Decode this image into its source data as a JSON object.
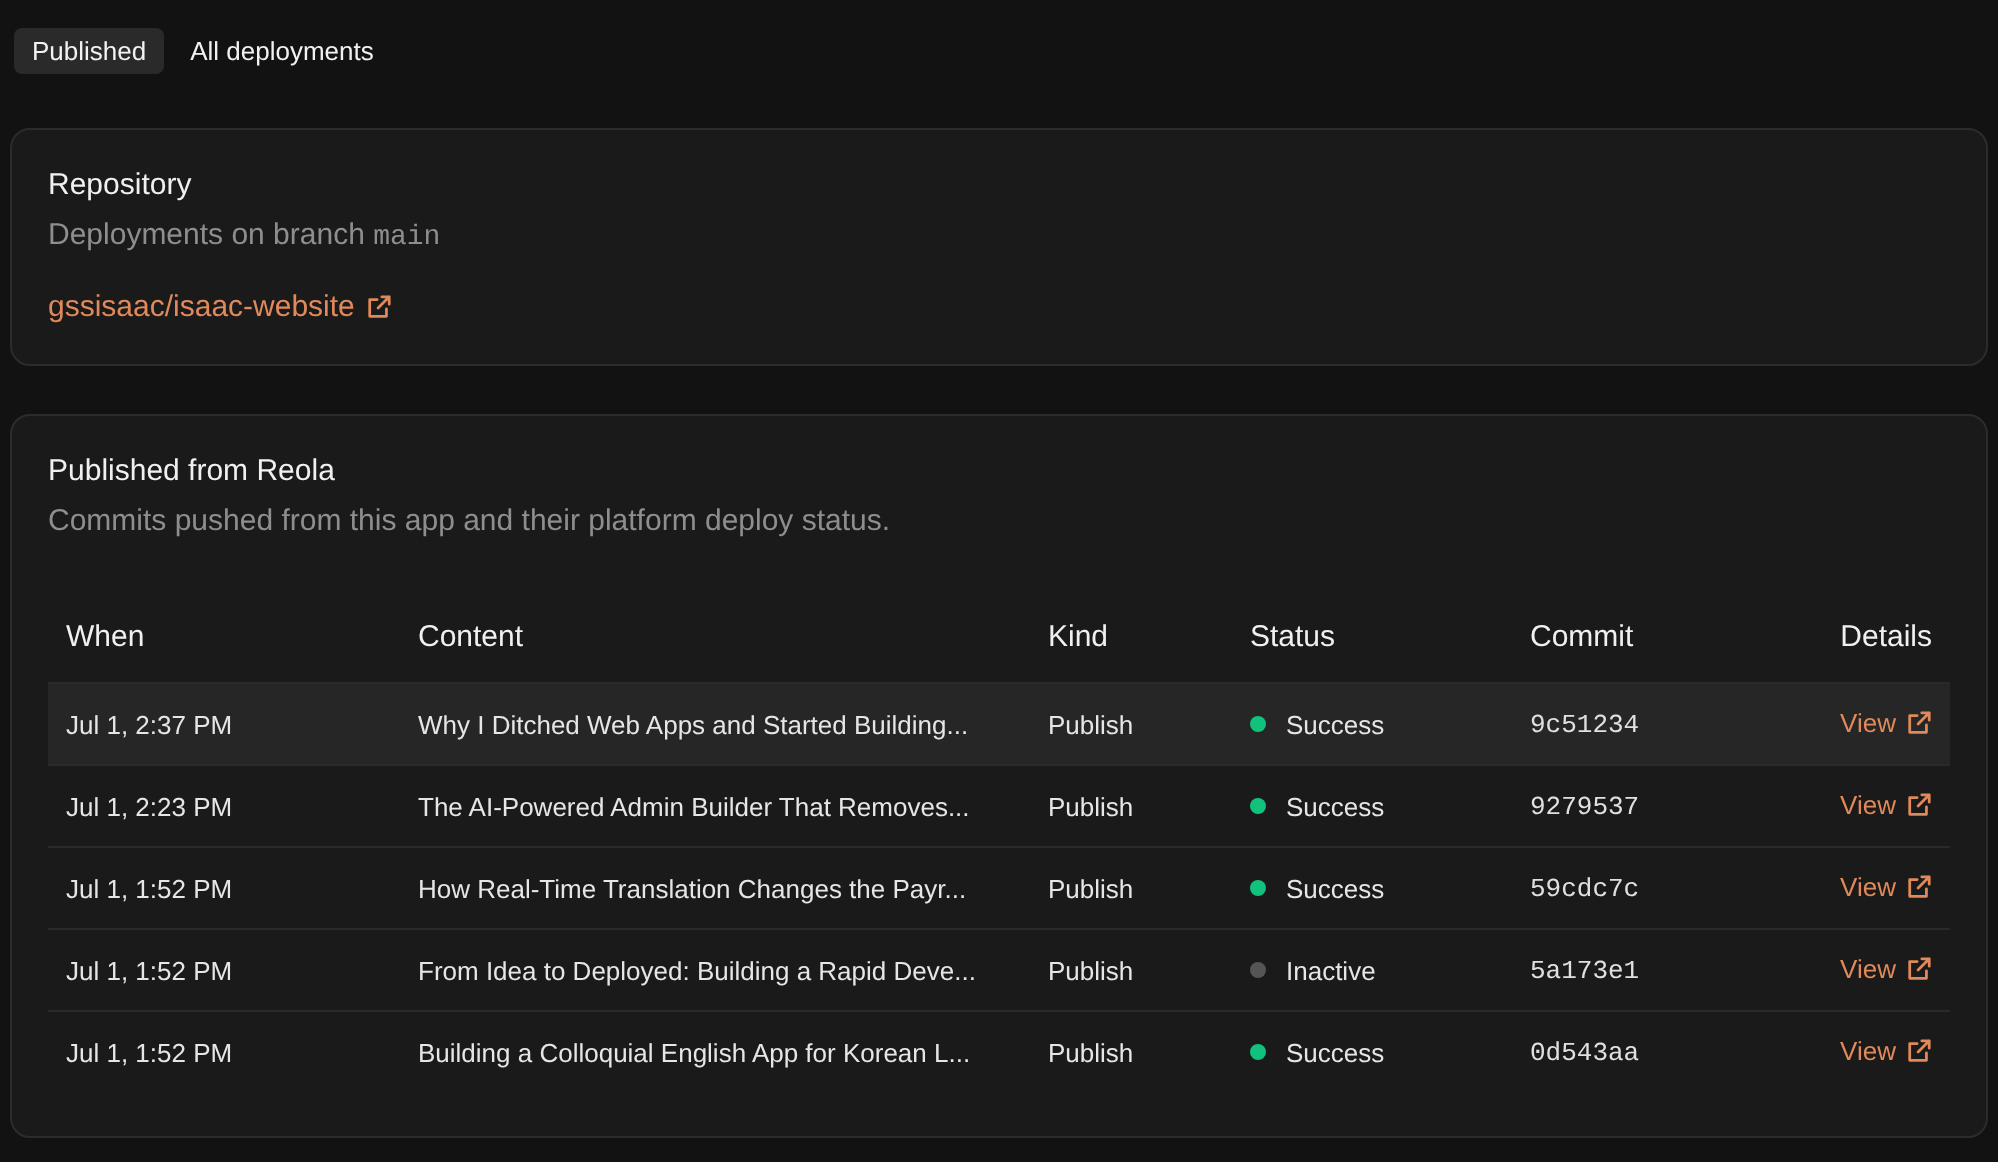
{
  "tabs": [
    {
      "label": "Published",
      "selected": true
    },
    {
      "label": "All deployments",
      "selected": false
    }
  ],
  "repository": {
    "title": "Repository",
    "description": "Deployments on branch",
    "branch": "main",
    "link": "gssisaac/isaac-website"
  },
  "published": {
    "title": "Published from Reola",
    "subtitle": "Commits pushed from this app and their platform deploy status.",
    "table": {
      "columns": [
        "When",
        "Content",
        "Kind",
        "Status",
        "Commit",
        "Details"
      ],
      "rows": [
        {
          "when": "Jul 1, 2:37 PM",
          "content": "Why I Ditched Web Apps and Started Building...",
          "kind": "Publish",
          "status": "Success",
          "color": "#10c27c",
          "commit": "9c51234",
          "details": "View",
          "selected": true
        },
        {
          "when": "Jul 1, 2:23 PM",
          "content": "The AI-Powered Admin Builder That Removes...",
          "kind": "Publish",
          "status": "Success",
          "color": "#10c27c",
          "commit": "9279537",
          "details": "View",
          "selected": false
        },
        {
          "when": "Jul 1, 1:52 PM",
          "content": "How Real-Time Translation Changes the Payr...",
          "kind": "Publish",
          "status": "Success",
          "color": "#10c27c",
          "commit": "59cdc7c",
          "details": "View",
          "selected": false
        },
        {
          "when": "Jul 1, 1:52 PM",
          "content": "From Idea to Deployed: Building a Rapid Deve...",
          "kind": "Publish",
          "status": "Inactive",
          "color": "#555555",
          "commit": "5a173e1",
          "details": "View",
          "selected": false
        },
        {
          "when": "Jul 1, 1:52 PM",
          "content": "Building a Colloquial English App for Korean L...",
          "kind": "Publish",
          "status": "Success",
          "color": "#10c27c",
          "commit": "0d543aa",
          "details": "View",
          "selected": false
        }
      ]
    }
  }
}
